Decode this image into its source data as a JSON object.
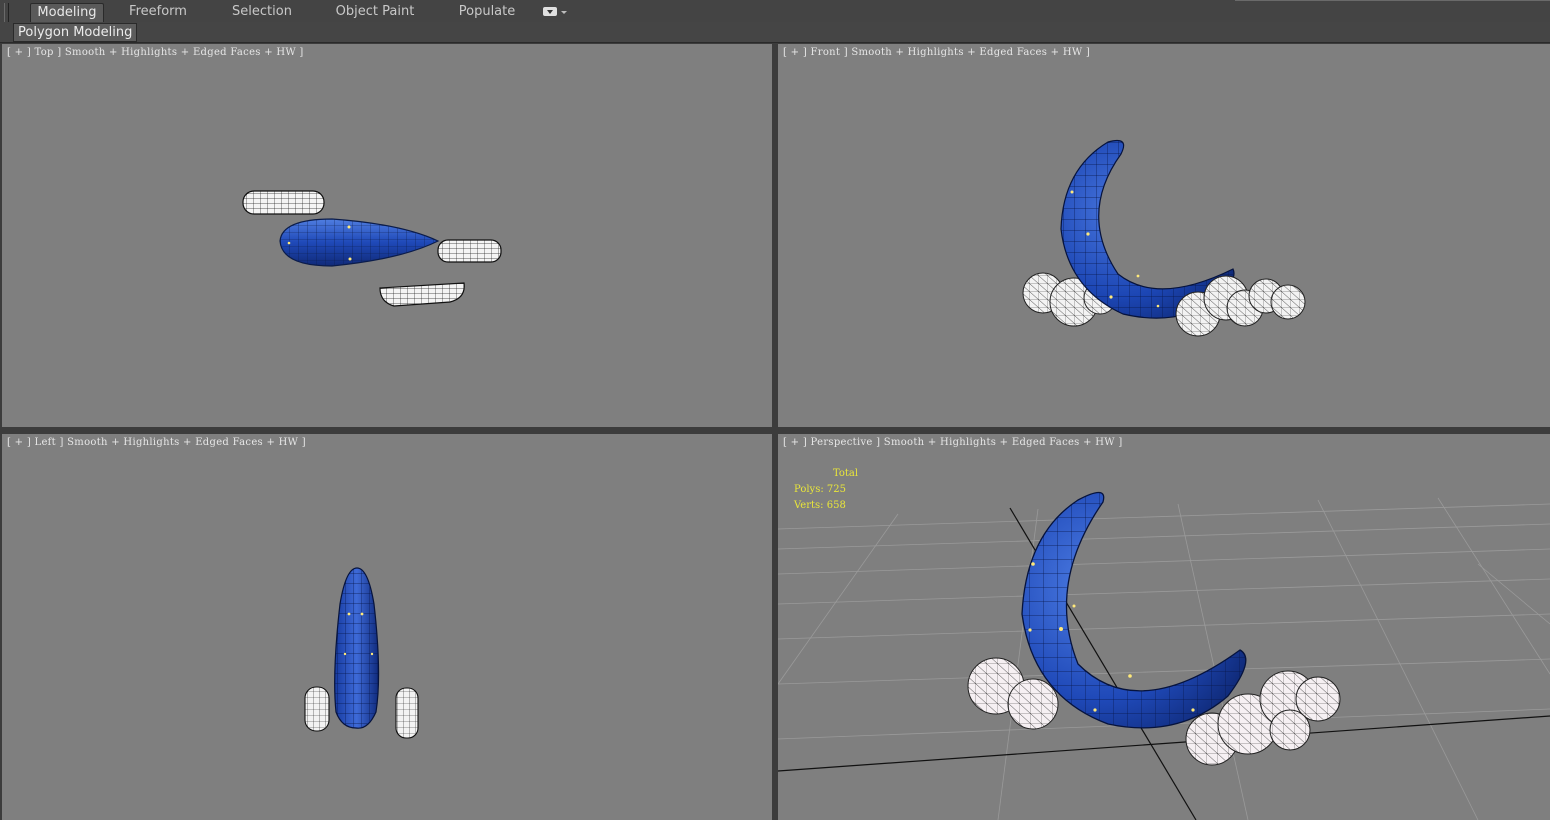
{
  "ribbon": {
    "tabs": [
      {
        "label": "Modeling",
        "active": true
      },
      {
        "label": "Freeform",
        "active": false
      },
      {
        "label": "Selection",
        "active": false
      },
      {
        "label": "Object Paint",
        "active": false
      },
      {
        "label": "Populate",
        "active": false
      }
    ],
    "sub_tab": "Polygon Modeling"
  },
  "viewports": {
    "top": {
      "label": "[ + ] Top ] Smooth + Highlights + Edged Faces + HW ]"
    },
    "front": {
      "label": "[ + ] Front ] Smooth + Highlights + Edged Faces + HW ]"
    },
    "left": {
      "label": "[ + ] Left ] Smooth + Highlights + Edged Faces + HW ]"
    },
    "perspective": {
      "label": "[ + ] Perspective ] Smooth + Highlights + Edged Faces + HW ]",
      "stats": {
        "header": "Total",
        "polys_label": "Polys:",
        "polys_value": "725",
        "verts_label": "Verts:",
        "verts_value": "658"
      }
    }
  },
  "colors": {
    "viewport_bg": "#7f7f7f",
    "moon_blue": "#1f49b8",
    "cloud_white": "#f2f2f2",
    "stats_yellow": "#e9e63a",
    "active_border": "#3a3a3a"
  }
}
